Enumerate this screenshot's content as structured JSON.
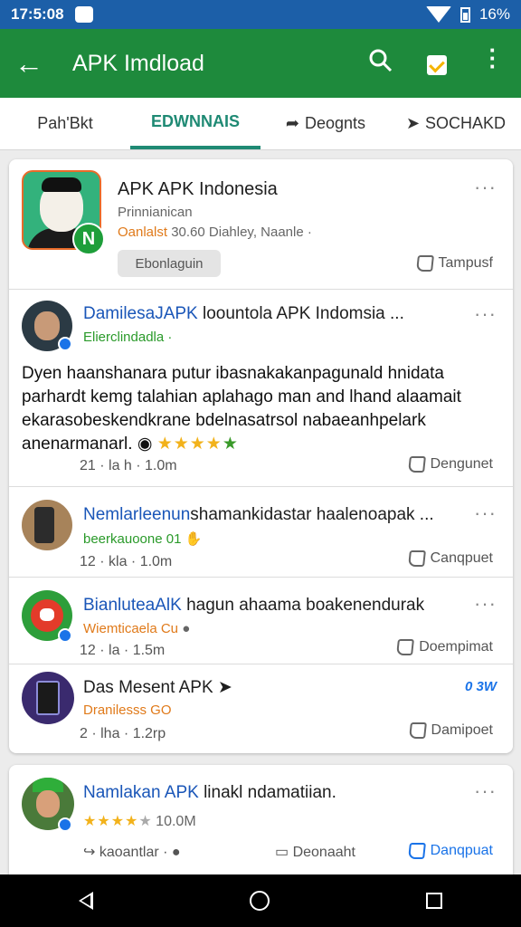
{
  "status": {
    "time": "17:5:08",
    "battery": "16%"
  },
  "appbar": {
    "title": "APK Imdload"
  },
  "tabs": [
    {
      "label": "Pah'Bkt"
    },
    {
      "label": "EDWNNAIS"
    },
    {
      "label": "Deognts"
    },
    {
      "label": "SOCHAKD"
    }
  ],
  "featured": {
    "title": "APK APK Indonesia",
    "subtitle": "Prinnianican",
    "meta_green": "Oanlalst",
    "meta_rest": "30.60 Diahley, Naanle ·",
    "chip": "Ebonlaguin",
    "action": "Tampusf"
  },
  "post": {
    "author": "DamilesaJAPK",
    "title_rest": "loountola APK Indomsia ...",
    "handle": "Elierclindadla ·",
    "body": "Dyen haanshanara putur ibasnakakanpagunald hnidata parhardt kemg talahian aplahago man and lhand alaamait ekarasobeskendkrane bdelnasatrsol nabaeanhpelark anenarmanarl.",
    "time": "21 · la h · 1.0m",
    "action": "Dengunet"
  },
  "items": [
    {
      "name_blue": "Nemlarleenun",
      "name_rest": "shamankidastar haalenoapak ...",
      "sub": "beerkauoone 01",
      "time": "12 · kla · 1.0m",
      "action": "Canqpuet"
    },
    {
      "name_blue": "BianluteaAlK",
      "name_rest": "hagun ahaama boakenendurak",
      "sub": "Wiemticaela Cu",
      "time": "12 · la · 1.5m",
      "action": "Doempimat"
    },
    {
      "name_blue": "",
      "name_rest": "Das Mesent APK",
      "sub": "Dranilesss GO",
      "time": "2 · lha · 1.2rp",
      "action": "Damipoet",
      "badge": "0 3W"
    }
  ],
  "card2": {
    "name_blue": "Namlakan APK",
    "name_rest": "linakl ndamatiian.",
    "rating": "10.0M",
    "left_action": "kaoantlar",
    "mid_action": "Deonaaht",
    "right_action": "Danqpuat"
  },
  "colors": {
    "appbar": "#1e8a3c",
    "statusbar": "#1c5fa8",
    "accent_tab": "#1f8a74",
    "link": "#1a56b8"
  }
}
